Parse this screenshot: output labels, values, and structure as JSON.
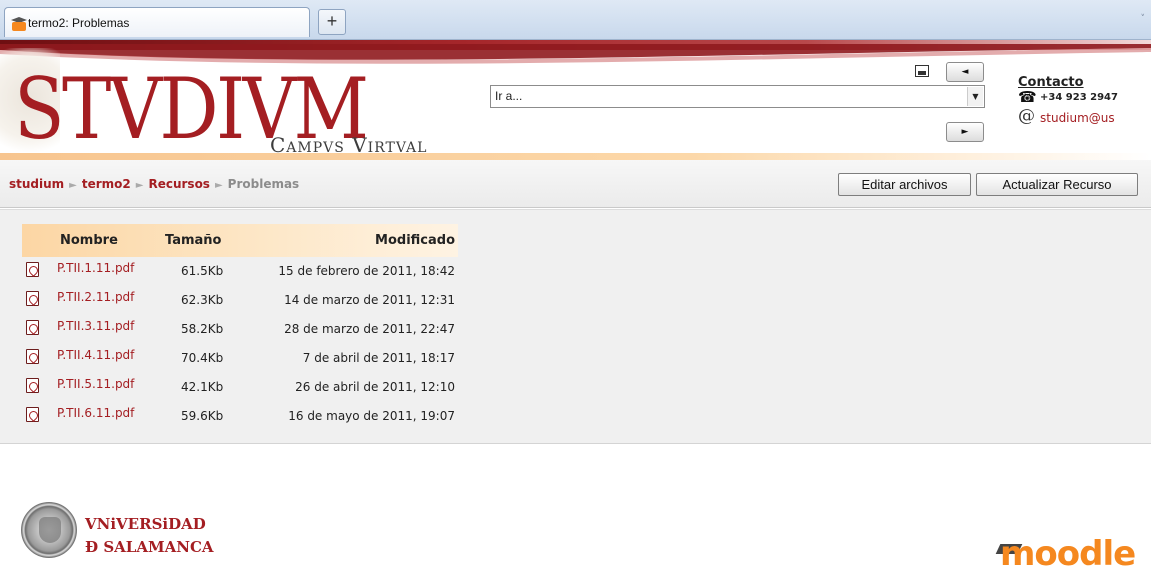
{
  "browser": {
    "tab_title": "termo2: Problemas",
    "new_tab_label": "+",
    "tab_menu_label": "˅"
  },
  "header": {
    "logo_text": "STVDIVM",
    "logo_subtitle": "Campvs Virtval",
    "goto": {
      "value": "Ir a...",
      "arrow": "▼"
    },
    "nav_prev_label": "◄",
    "nav_next_label": "►",
    "contact": {
      "title": "Contacto",
      "phone_icon": "☎",
      "phone": "+34 923 2947",
      "mail_icon": "@",
      "email": "studium@us"
    }
  },
  "navbar": {
    "breadcrumb": [
      {
        "label": "studium",
        "link": true
      },
      {
        "label": "termo2",
        "link": true
      },
      {
        "label": "Recursos",
        "link": true
      },
      {
        "label": "Problemas",
        "link": false
      }
    ],
    "separator": "►",
    "buttons": {
      "edit_files": "Editar archivos",
      "update_resource": "Actualizar Recurso"
    }
  },
  "files": {
    "columns": {
      "name": "Nombre",
      "size": "Tamaño",
      "modified": "Modificado"
    },
    "rows": [
      {
        "name": "P.TII.1.11.pdf",
        "size": "61.5Kb",
        "modified": "15 de febrero de 2011, 18:42"
      },
      {
        "name": "P.TII.2.11.pdf",
        "size": "62.3Kb",
        "modified": "14 de marzo de 2011, 12:31"
      },
      {
        "name": "P.TII.3.11.pdf",
        "size": "58.2Kb",
        "modified": "28 de marzo de 2011, 22:47"
      },
      {
        "name": "P.TII.4.11.pdf",
        "size": "70.4Kb",
        "modified": "7 de abril de 2011, 18:17"
      },
      {
        "name": "P.TII.5.11.pdf",
        "size": "42.1Kb",
        "modified": "26 de abril de 2011, 12:10"
      },
      {
        "name": "P.TII.6.11.pdf",
        "size": "59.6Kb",
        "modified": "16 de mayo de 2011, 19:07"
      }
    ]
  },
  "footer": {
    "university_line1": "VNiVERSiDAD",
    "university_line2": "Ð SALAMANCA",
    "moodle": "moodle"
  },
  "colors": {
    "brand_red": "#a41e22",
    "accent_orange": "#f5881f",
    "table_header": "#fcd6a4"
  }
}
